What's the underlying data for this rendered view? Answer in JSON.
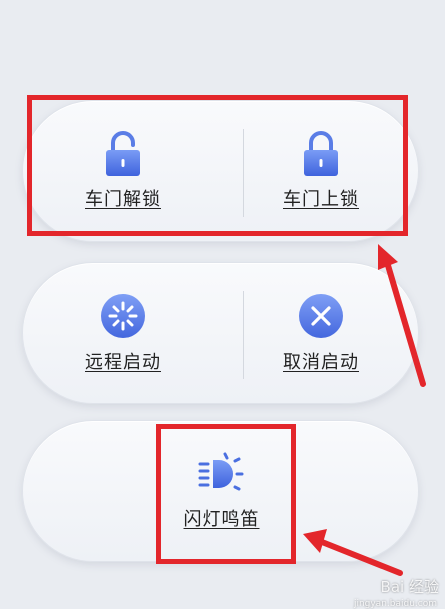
{
  "controls": {
    "unlock_label": "车门解锁",
    "lock_label": "车门上锁",
    "remote_start_label": "远程启动",
    "cancel_start_label": "取消启动",
    "flash_honk_label": "闪灯鸣笛"
  },
  "watermark": {
    "brand": "Bai",
    "suffix": "经验",
    "url": "jingyan.baidu.com"
  },
  "colors": {
    "background": "#e9ecf1",
    "icon_blue": "#4a6fe0",
    "annotation_red": "#e3262b"
  }
}
